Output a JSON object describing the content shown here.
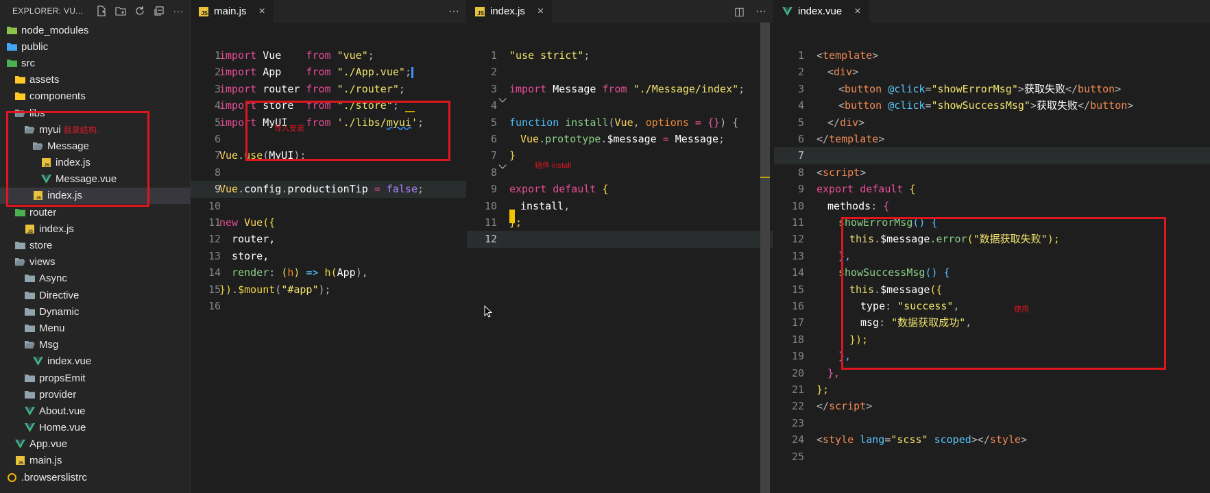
{
  "explorer": {
    "title": "EXPLORER: VU...",
    "items": [
      {
        "label": "node_modules",
        "depth": 0,
        "icon": "folder-node-icon",
        "color": "#8bc34a"
      },
      {
        "label": "public",
        "depth": 0,
        "icon": "folder-public-icon",
        "color": "#42a5f5"
      },
      {
        "label": "src",
        "depth": 0,
        "icon": "folder-src-icon",
        "color": "#4caf50"
      },
      {
        "label": "assets",
        "depth": 1,
        "icon": "folder-icon",
        "color": "#ffca28"
      },
      {
        "label": "components",
        "depth": 1,
        "icon": "folder-components-icon",
        "color": "#ffca28"
      },
      {
        "label": "libs",
        "depth": 1,
        "icon": "folder-open-icon",
        "color": "#90a4ae"
      },
      {
        "label": "myui",
        "depth": 2,
        "icon": "folder-open-icon",
        "color": "#90a4ae",
        "note": "目录结构."
      },
      {
        "label": "Message",
        "depth": 3,
        "icon": "folder-open-icon",
        "color": "#90a4ae"
      },
      {
        "label": "index.js",
        "depth": 4,
        "icon": "js-file-icon",
        "color": "#e8c23a"
      },
      {
        "label": "Message.vue",
        "depth": 4,
        "icon": "vue-file-icon",
        "color": "#41b883"
      },
      {
        "label": "index.js",
        "depth": 3,
        "icon": "js-file-icon",
        "color": "#e8c23a",
        "selected": true
      },
      {
        "label": "router",
        "depth": 1,
        "icon": "folder-router-icon",
        "color": "#4caf50"
      },
      {
        "label": "index.js",
        "depth": 2,
        "icon": "js-file-icon",
        "color": "#e8c23a"
      },
      {
        "label": "store",
        "depth": 1,
        "icon": "folder-icon",
        "color": "#90a4ae"
      },
      {
        "label": "views",
        "depth": 1,
        "icon": "folder-open-icon",
        "color": "#90a4ae"
      },
      {
        "label": "Async",
        "depth": 2,
        "icon": "folder-icon",
        "color": "#90a4ae"
      },
      {
        "label": "Directive",
        "depth": 2,
        "icon": "folder-icon",
        "color": "#90a4ae"
      },
      {
        "label": "Dynamic",
        "depth": 2,
        "icon": "folder-icon",
        "color": "#90a4ae"
      },
      {
        "label": "Menu",
        "depth": 2,
        "icon": "folder-icon",
        "color": "#90a4ae"
      },
      {
        "label": "Msg",
        "depth": 2,
        "icon": "folder-open-icon",
        "color": "#90a4ae"
      },
      {
        "label": "index.vue",
        "depth": 3,
        "icon": "vue-file-icon",
        "color": "#41b883"
      },
      {
        "label": "propsEmit",
        "depth": 2,
        "icon": "folder-icon",
        "color": "#90a4ae"
      },
      {
        "label": "provider",
        "depth": 2,
        "icon": "folder-icon",
        "color": "#90a4ae"
      },
      {
        "label": "About.vue",
        "depth": 2,
        "icon": "vue-file-icon",
        "color": "#41b883"
      },
      {
        "label": "Home.vue",
        "depth": 2,
        "icon": "vue-file-icon",
        "color": "#41b883"
      },
      {
        "label": "App.vue",
        "depth": 1,
        "icon": "vue-file-icon",
        "color": "#41b883"
      },
      {
        "label": "main.js",
        "depth": 1,
        "icon": "js-file-icon",
        "color": "#e8c23a"
      },
      {
        "label": ".browserslistrc",
        "depth": 0,
        "icon": "browserslist-icon",
        "color": "#f0b400"
      }
    ]
  },
  "tabs": {
    "main": {
      "label": "main.js",
      "close": "×"
    },
    "index_js": {
      "label": "index.js",
      "close": "×"
    },
    "index_vue": {
      "label": "index.vue",
      "close": "×"
    },
    "more": "···",
    "split": "◫",
    "badge": "JS"
  },
  "annotations": {
    "tree": "目录结构.",
    "main": "导入安装",
    "plugin": "插件 install",
    "usage": "使用"
  },
  "main_js": {
    "lines": [
      "1",
      "2",
      "3",
      "4",
      "5",
      "6",
      "7",
      "8",
      "9",
      "10",
      "11",
      "12",
      "13",
      "14",
      "15",
      "16"
    ],
    "code": {
      "l1": [
        "import",
        " Vue",
        "    from ",
        "\"vue\"",
        ";"
      ],
      "l2": [
        "import",
        " App",
        "    from ",
        "\"./App.vue\"",
        ";"
      ],
      "l3": [
        "import",
        " router",
        " from ",
        "\"./router\"",
        ";"
      ],
      "l4": [
        "import",
        " store",
        "  from ",
        "\"./store\"",
        ";"
      ],
      "l5": [
        "import",
        " MyUI",
        "   from ",
        "'./libs/",
        "myui",
        "'",
        ";"
      ],
      "l7": [
        "Vue",
        ".",
        "use",
        "(",
        "MyUI",
        ");"
      ],
      "l9": [
        "Vue",
        ".",
        "config",
        ".",
        "productionTip",
        " = ",
        "false",
        ";"
      ],
      "l11": [
        "new ",
        "Vue",
        "({"
      ],
      "l12": [
        "  router,"
      ],
      "l13": [
        "  store,"
      ],
      "l14": [
        "  render",
        ": ",
        "(",
        "h",
        ") ",
        "=>",
        " h",
        "(",
        "App",
        "),"
      ],
      "l15": [
        "})",
        ".",
        "$mount",
        "(",
        "\"#app\"",
        ");"
      ]
    }
  },
  "index_js": {
    "lines": [
      "1",
      "2",
      "3",
      "4",
      "5",
      "6",
      "7",
      "8",
      "9",
      "10",
      "11",
      "12"
    ],
    "code": {
      "l1": [
        "\"use strict\"",
        ";"
      ],
      "l3": [
        "import",
        " Message ",
        "from",
        " \"./Message/index\"",
        ";"
      ],
      "l5": [
        "function",
        " install",
        "(",
        "Vue",
        ", ",
        "options",
        " = ",
        "{}",
        ") {"
      ],
      "l6": [
        "Vue",
        ".",
        "prototype",
        ".",
        "$message",
        " = ",
        "Message",
        ";"
      ],
      "l7": [
        "}"
      ],
      "l9": [
        "export",
        " default",
        " {"
      ],
      "l10": [
        "install",
        ","
      ],
      "l11": [
        "};"
      ]
    }
  },
  "index_vue": {
    "lines": [
      "1",
      "2",
      "3",
      "4",
      "5",
      "6",
      "7",
      "8",
      "9",
      "10",
      "11",
      "12",
      "13",
      "14",
      "15",
      "16",
      "17",
      "18",
      "19",
      "20",
      "21",
      "22",
      "23",
      "24",
      "25"
    ],
    "code": {
      "l1": [
        "<",
        "template",
        ">"
      ],
      "l2": [
        "<",
        "div",
        ">"
      ],
      "l3": [
        "<",
        "button",
        " @",
        "click",
        "=",
        "\"showErrorMsg\"",
        ">",
        "获取失败",
        "</",
        "button",
        ">"
      ],
      "l4": [
        "<",
        "button",
        " @",
        "click",
        "=",
        "\"showSuccessMsg\"",
        ">",
        "获取失败",
        "</",
        "button",
        ">"
      ],
      "l5": [
        "</",
        "div",
        ">"
      ],
      "l6": [
        "</",
        "template",
        ">"
      ],
      "l8": [
        "<",
        "script",
        ">"
      ],
      "l9": [
        "export",
        " default",
        " {"
      ],
      "l10": [
        "methods",
        ": ",
        "{"
      ],
      "l11": [
        "showErrorMsg",
        "() ",
        "{"
      ],
      "l12": [
        "this",
        ".",
        "$message",
        ".",
        "error",
        "(",
        "\"数据获取失败\"",
        ");"
      ],
      "l13": [
        "},"
      ],
      "l14": [
        "showSuccessMsg",
        "() ",
        "{"
      ],
      "l15": [
        "this",
        ".",
        "$message",
        "({"
      ],
      "l16": [
        "type",
        ": ",
        "\"success\"",
        ","
      ],
      "l17": [
        "msg",
        ": ",
        "\"数据获取成功\"",
        ","
      ],
      "l18": [
        "});"
      ],
      "l19": [
        "},"
      ],
      "l20": [
        "},"
      ],
      "l21": [
        "};"
      ],
      "l22": [
        "</",
        "script",
        ">"
      ],
      "l24": [
        "<",
        "style",
        " lang",
        "=",
        "\"scss\"",
        " scoped",
        "></",
        "style",
        ">"
      ]
    }
  },
  "colors": {
    "annotation_red": "#e0161f",
    "js_yellow": "#e8c23a",
    "vue_green": "#41b883",
    "editor_bg": "#1e1e1e",
    "sidebar_bg": "#252526"
  }
}
